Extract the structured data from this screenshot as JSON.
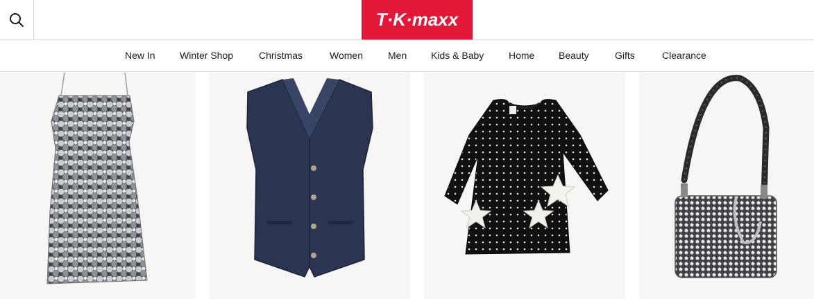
{
  "header": {
    "search_icon": "search-icon",
    "logo_text": "T·K·maxx",
    "logo_color": "#e31837"
  },
  "nav": {
    "items": [
      {
        "label": "New In"
      },
      {
        "label": "Winter Shop"
      },
      {
        "label": "Christmas"
      },
      {
        "label": "Women"
      },
      {
        "label": "Men"
      },
      {
        "label": "Kids & Baby"
      },
      {
        "label": "Home"
      },
      {
        "label": "Beauty"
      },
      {
        "label": "Gifts"
      },
      {
        "label": "Clearance"
      }
    ]
  },
  "products": [
    {
      "image": "silver sequin mini dress"
    },
    {
      "image": "navy waistcoat"
    },
    {
      "image": "black polka dot dress with star appliqués"
    },
    {
      "image": "crystal embellished shoulder bag"
    }
  ],
  "colors": {
    "brand_red": "#e31837",
    "tile_bg": "#f7f6f4",
    "divider": "#d6d6d6"
  }
}
